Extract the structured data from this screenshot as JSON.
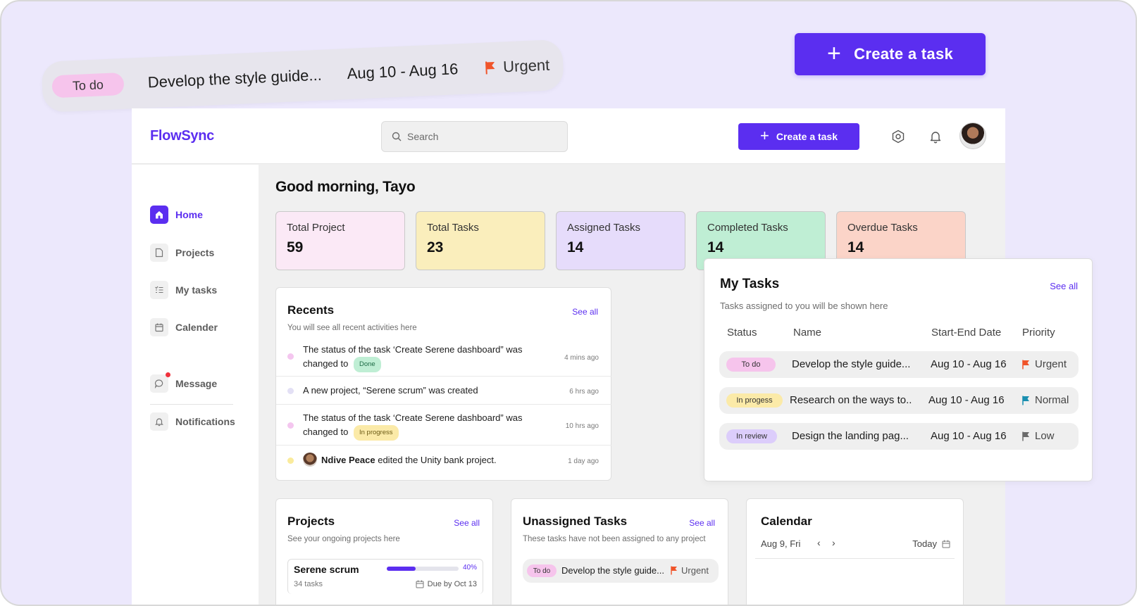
{
  "float_create": {
    "label": "Create a task",
    "icon": "plus-icon"
  },
  "float_task": {
    "status": "To do",
    "name": "Develop the style guide...",
    "dates": "Aug 10 - Aug 16",
    "priority": "Urgent"
  },
  "app": {
    "logo": "FlowSync"
  },
  "search": {
    "placeholder": "Search"
  },
  "header": {
    "create_label": "Create a task"
  },
  "sidebar": {
    "items": [
      {
        "label": "Home",
        "icon": "home-icon"
      },
      {
        "label": "Projects",
        "icon": "folder-icon"
      },
      {
        "label": "My tasks",
        "icon": "checklist-icon"
      },
      {
        "label": "Calender",
        "icon": "calendar-icon"
      },
      {
        "label": "Message",
        "icon": "message-icon"
      },
      {
        "label": "Notifications",
        "icon": "bell-icon"
      }
    ]
  },
  "greeting": "Good morning, Tayo",
  "stats": [
    {
      "label": "Total Project",
      "value": "59",
      "color": "#fbe9f6"
    },
    {
      "label": "Total Tasks",
      "value": "23",
      "color": "#faeebc"
    },
    {
      "label": "Assigned Tasks",
      "value": "14",
      "color": "#e6dcfb"
    },
    {
      "label": "Completed Tasks",
      "value": "14",
      "color": "#bfeed4"
    },
    {
      "label": "Overdue Tasks",
      "value": "14",
      "color": "#fbd4c8"
    }
  ],
  "recents": {
    "title": "Recents",
    "subtitle": "You will see all recent activities here",
    "see_all": "See all",
    "items": [
      {
        "text": "The status of  the task ‘Create Serene dashboard” was changed to",
        "badge": "Done",
        "time": "4 mins ago"
      },
      {
        "text": "A new project, “Serene scrum” was created",
        "time": "6 hrs ago"
      },
      {
        "text": "The status of  the task ‘Create Serene dashboard” was changed to",
        "badge": "In progress",
        "time": "10 hrs ago"
      },
      {
        "actor": "Ndive Peace",
        "text": " edited the Unity bank project.",
        "time": "1 day ago"
      }
    ]
  },
  "my_tasks": {
    "title": "My Tasks",
    "subtitle": "Tasks assigned to you will be shown here",
    "see_all": "See all",
    "columns": [
      "Status",
      "Name",
      "Start-End Date",
      "Priority"
    ],
    "rows": [
      {
        "status": "To do",
        "name": "Develop the style guide...",
        "dates": "Aug 10 - Aug 16",
        "priority": "Urgent"
      },
      {
        "status": "In progess",
        "name": "Research on the ways to..",
        "dates": "Aug 10 - Aug 16",
        "priority": "Normal"
      },
      {
        "status": "In review",
        "name": "Design the landing pag...",
        "dates": "Aug 10 - Aug 16",
        "priority": "Low"
      }
    ]
  },
  "projects": {
    "title": "Projects",
    "subtitle": "See your ongoing projects here",
    "see_all": "See all",
    "items": [
      {
        "name": "Serene scrum",
        "progress": 40,
        "progress_label": "40%",
        "tasks": "34 tasks",
        "due": "Due by Oct 13"
      }
    ]
  },
  "unassigned": {
    "title": "Unassigned Tasks",
    "subtitle": "These tasks have not been assigned to any project",
    "see_all": "See all",
    "items": [
      {
        "status": "To do",
        "name": "Develop the style guide...",
        "priority": "Urgent"
      }
    ]
  },
  "calendar": {
    "title": "Calendar",
    "date": "Aug 9, Fri",
    "today": "Today"
  },
  "colors": {
    "accent": "#5b2ef0",
    "urgent": "#f0542a",
    "normal": "#1a8fb0",
    "low": "#6a6a6a",
    "todo_pill": "#f6c4ec",
    "progress_pill": "#fbeaa8",
    "review_pill": "#dccdfb",
    "done_pill": "#bfeed4"
  }
}
